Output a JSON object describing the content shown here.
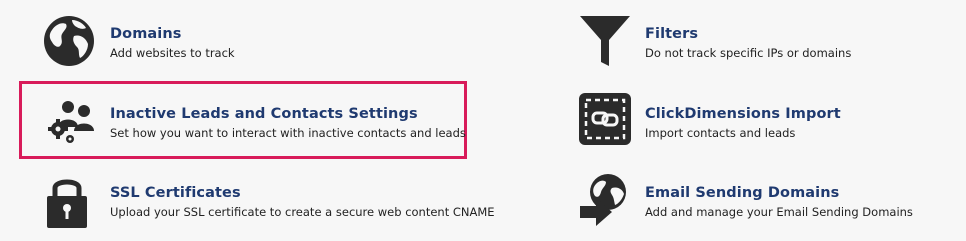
{
  "settings": {
    "items": [
      {
        "title": "Domains",
        "description": "Add websites to track",
        "icon": "globe-icon"
      },
      {
        "title": "Filters",
        "description": "Do not track specific IPs or domains",
        "icon": "funnel-icon"
      },
      {
        "title": "Inactive Leads and Contacts Settings",
        "description": "Set how you want to interact with inactive contacts and leads",
        "icon": "people-gear-icon"
      },
      {
        "title": "ClickDimensions Import",
        "description": "Import contacts and leads",
        "icon": "import-link-icon"
      },
      {
        "title": "SSL Certificates",
        "description": "Upload your SSL certificate to create a secure web content CNAME",
        "icon": "padlock-icon"
      },
      {
        "title": "Email Sending Domains",
        "description": "Add and manage your Email Sending Domains",
        "icon": "globe-arrow-icon"
      }
    ]
  },
  "colors": {
    "title": "#1f3a70",
    "highlight_border": "#d81b5a",
    "icon": "#2b2b2b"
  }
}
